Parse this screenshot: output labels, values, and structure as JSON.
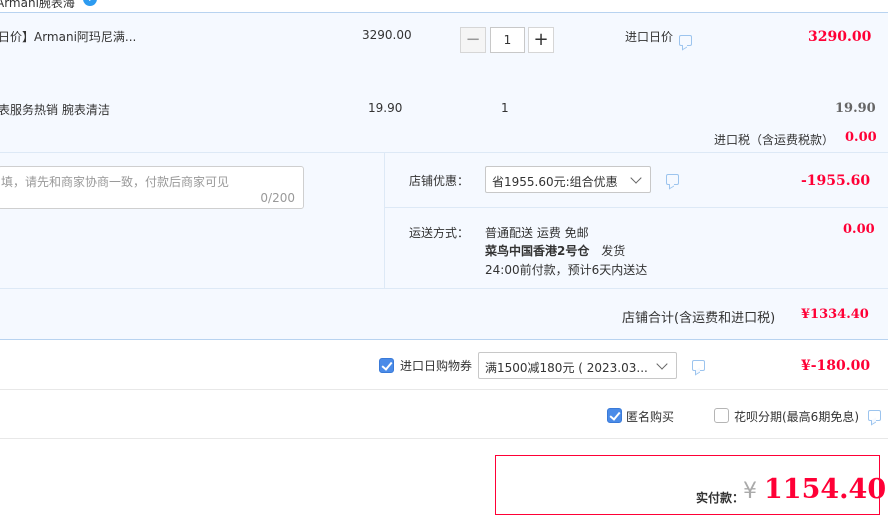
{
  "store": {
    "name": "Armani腕表海",
    "badge": "?"
  },
  "items": [
    {
      "name": "日价】Armani阿玛尼满...",
      "unit_price": "3290.00",
      "qty": "1",
      "tag": "进口日价",
      "subtotal": "3290.00"
    },
    {
      "name": "表服务热销 腕表清洁",
      "unit_price": "19.90",
      "qty": "1",
      "subtotal": "19.90"
    }
  ],
  "qty_controls": {
    "minus": "−",
    "plus": "+"
  },
  "import_tax": {
    "label": "进口税（含运费税款）",
    "amount": "0.00"
  },
  "message": {
    "placeholder": "填，请先和商家协商一致，付款后商家可见",
    "count": "0/200"
  },
  "store_discount": {
    "label": "店铺优惠：",
    "selected": "省1955.60元:组合优惠",
    "amount": "-1955.60"
  },
  "shipping": {
    "label": "运送方式：",
    "line1": "普通配送 运费 免邮",
    "line2_bold": "菜鸟中国香港2号仓",
    "line2_rest": "发货",
    "line3": "24:00前付款，预计6天内送达",
    "amount": "0.00"
  },
  "store_total": {
    "label": "店铺合计(含运费和进口税)",
    "amount": "¥1334.40"
  },
  "coupon": {
    "checked": true,
    "label": "进口日购物券",
    "selected": "满1500减180元 ( 2023.03...",
    "amount": "¥-180.00"
  },
  "anonymous": {
    "checked": true,
    "label": "匿名购买"
  },
  "huabei": {
    "checked": false,
    "label": "花呗分期(最高6期免息)"
  },
  "payment": {
    "label": "实付款：",
    "currency": "¥",
    "amount": "1154.40"
  },
  "colors": {
    "accent": "#ff0036",
    "checkbox": "#4a8be8",
    "panel": "#f5f9ff"
  },
  "icons": [
    "help-icon",
    "chat-icon",
    "chevron-down-icon",
    "checkbox-checked-icon"
  ]
}
